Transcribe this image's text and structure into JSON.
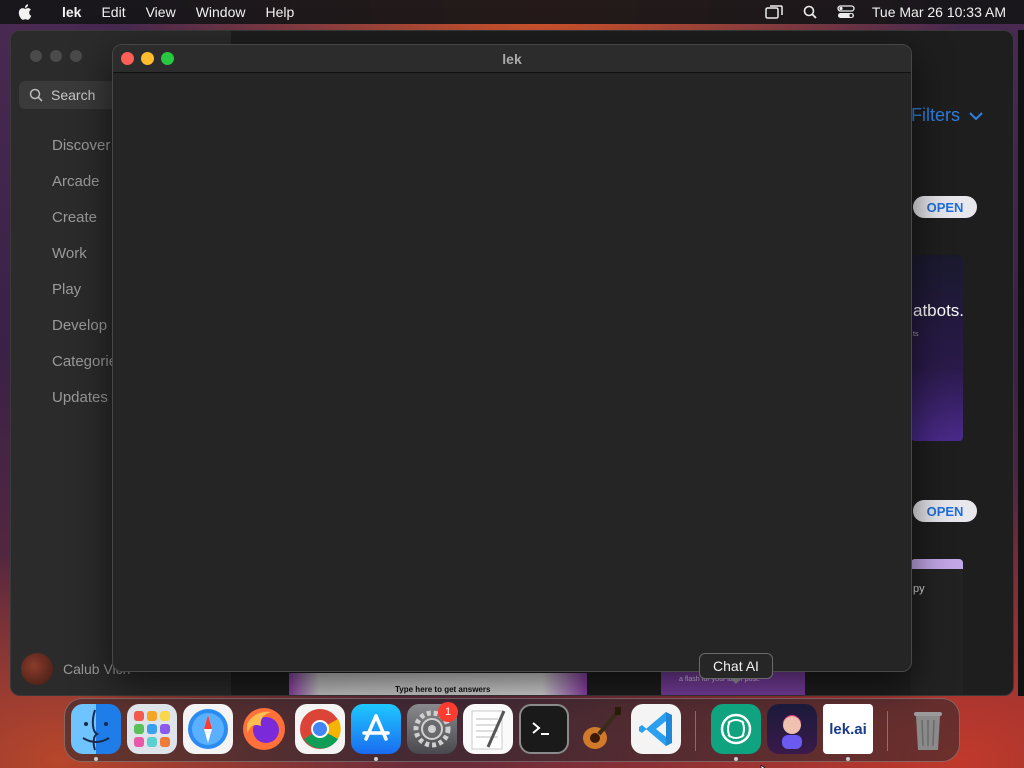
{
  "menubar": {
    "app_name": "lek",
    "items": [
      "Edit",
      "View",
      "Window",
      "Help"
    ],
    "clock": "Tue Mar 26  10:33 AM"
  },
  "store": {
    "search_placeholder": "Search",
    "nav": [
      "Discover",
      "Arcade",
      "Create",
      "Work",
      "Play",
      "Develop",
      "Categories",
      "Updates"
    ],
    "user_name": "Calub Vich",
    "filters_label": "Filters",
    "open_label": "OPEN",
    "card1_title": "atbots.",
    "card1_sub": "ts",
    "card2_title": "py",
    "strip_a_text": "Type here to get answers",
    "strip_b_text": "a flash for your latter post."
  },
  "window": {
    "title": "lek"
  },
  "tooltip": {
    "text": "Chat AI"
  },
  "dock": {
    "badge": "1",
    "apps": [
      "Finder",
      "Launchpad",
      "Safari",
      "Firefox",
      "Chrome",
      "App Store",
      "System Settings",
      "TextEdit",
      "Terminal",
      "GarageBand",
      "Visual Studio Code",
      "Chat AI",
      "AI Assistant",
      "lek.ai",
      "Trash"
    ],
    "lek_label": "lek.ai"
  }
}
